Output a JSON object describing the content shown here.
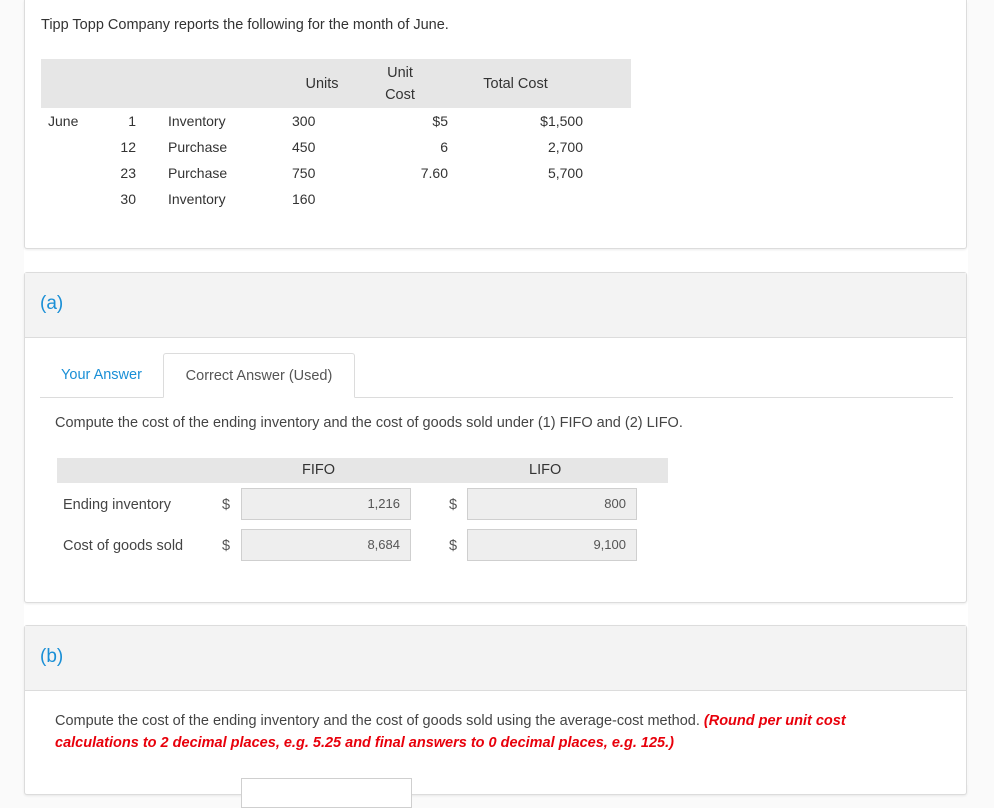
{
  "problem": {
    "intro": "Tipp Topp Company reports the following for the month of June.",
    "table": {
      "headers": {
        "units": "Units",
        "unit_cost_line1": "Unit",
        "unit_cost_line2": "Cost",
        "total_cost": "Total Cost"
      },
      "rows": [
        {
          "month": "June",
          "day": "1",
          "description": "Inventory",
          "units": "300",
          "unit_cost": "$5",
          "total_cost": "$1,500"
        },
        {
          "month": "",
          "day": "12",
          "description": "Purchase",
          "units": "450",
          "unit_cost": "6",
          "total_cost": "2,700"
        },
        {
          "month": "",
          "day": "23",
          "description": "Purchase",
          "units": "750",
          "unit_cost": "7.60",
          "total_cost": "5,700"
        },
        {
          "month": "",
          "day": "30",
          "description": "Inventory",
          "units": "160",
          "unit_cost": "",
          "total_cost": ""
        }
      ]
    }
  },
  "section_a": {
    "label": "(a)",
    "tabs": [
      {
        "label": "Your Answer",
        "active": false
      },
      {
        "label": "Correct Answer (Used)",
        "active": true
      }
    ],
    "instruction": "Compute the cost of the ending inventory and the cost of goods sold under (1) FIFO and (2) LIFO.",
    "columns": [
      "FIFO",
      "LIFO"
    ],
    "currency_symbol": "$",
    "rows": [
      {
        "label": "Ending inventory",
        "fifo": "1,216",
        "lifo": "800"
      },
      {
        "label": "Cost of goods sold",
        "fifo": "8,684",
        "lifo": "9,100"
      }
    ]
  },
  "section_b": {
    "label": "(b)",
    "instruction": "Compute the cost of the ending inventory and the cost of goods sold using the average-cost method.",
    "note": "(Round per unit cost calculations to 2 decimal places, e.g. 5.25 and final answers to 0 decimal places, e.g. 125.)",
    "input_value": ""
  },
  "colors": {
    "accent_blue": "#1a8fd6",
    "note_red": "#e8000b",
    "header_gray": "#e6e6e6"
  }
}
